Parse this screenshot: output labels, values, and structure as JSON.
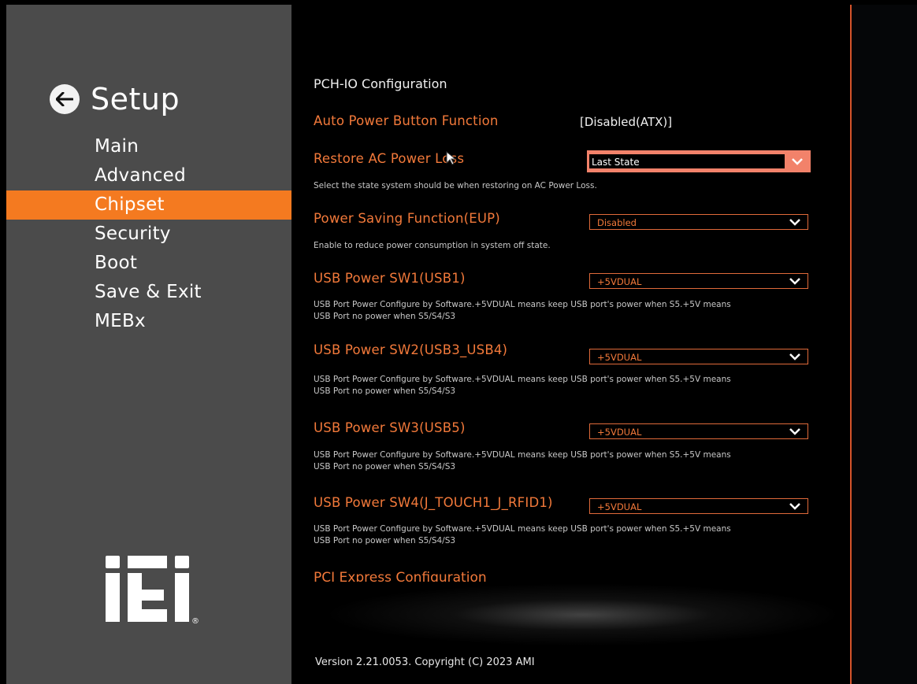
{
  "setup": {
    "title": "Setup",
    "back_icon": "arrow-left-icon"
  },
  "nav": [
    {
      "label": "Main",
      "active": false
    },
    {
      "label": "Advanced",
      "active": false
    },
    {
      "label": "Chipset",
      "active": true
    },
    {
      "label": "Security",
      "active": false
    },
    {
      "label": "Boot",
      "active": false
    },
    {
      "label": "Save & Exit",
      "active": false
    },
    {
      "label": "MEBx",
      "active": false
    }
  ],
  "logo": {
    "text": "iEi",
    "mark": "®"
  },
  "main": {
    "section_title": "PCH-IO Configuration",
    "auto_power": {
      "label": "Auto Power Button Function",
      "value": "[Disabled(ATX)]"
    },
    "restore_ac": {
      "label": "Restore AC Power Loss",
      "value": "Last State",
      "help": "Select the state system should be when restoring on AC Power Loss."
    },
    "power_saving": {
      "label": "Power Saving Function(EUP)",
      "value": "Disabled",
      "help": "Enable to reduce power consumption in system off state."
    },
    "usb_sw1": {
      "label": "USB Power SW1(USB1)",
      "value": "+5VDUAL",
      "help1": "USB Port Power Configure by Software.+5VDUAL means keep USB port's power when S5.+5V means",
      "help2": "USB Port no power when S5/S4/S3"
    },
    "usb_sw2": {
      "label": "USB Power SW2(USB3_USB4)",
      "value": "+5VDUAL",
      "help1": "USB Port Power Configure by Software.+5VDUAL means keep USB port's power when S5.+5V means",
      "help2": "USB Port no power when S5/S4/S3"
    },
    "usb_sw3": {
      "label": "USB Power SW3(USB5)",
      "value": "+5VDUAL",
      "help1": "USB Port Power Configure by Software.+5VDUAL means keep USB port's power when S5.+5V means",
      "help2": "USB Port no power when S5/S4/S3"
    },
    "usb_sw4": {
      "label": "USB Power SW4(J_TOUCH1_J_RFID1)",
      "value": "+5VDUAL",
      "help1": "USB Port Power Configure by Software.+5VDUAL means keep USB port's power when S5.+5V means",
      "help2": "USB Port no power when S5/S4/S3"
    },
    "pci_express": {
      "label": "PCI Express Configuration"
    },
    "version": "Version 2.21.0053. Copyright (C) 2023 AMI"
  },
  "colors": {
    "accent": "#f47a20",
    "label": "#f2793a",
    "sidebar": "#4b4b4b",
    "divider": "#d5542b",
    "selected_box": "#f2826a"
  }
}
